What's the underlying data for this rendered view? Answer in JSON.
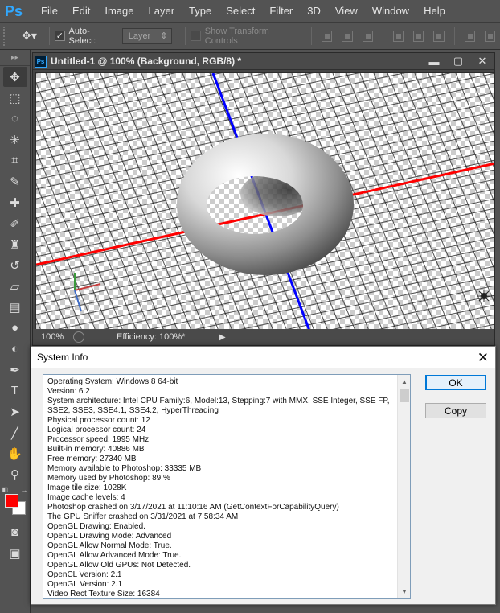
{
  "app": {
    "logo": "Ps"
  },
  "menu": [
    "File",
    "Edit",
    "Image",
    "Layer",
    "Type",
    "Select",
    "Filter",
    "3D",
    "View",
    "Window",
    "Help"
  ],
  "options": {
    "move_icon": "move-tool-icon",
    "auto_select_label": "Auto-Select:",
    "auto_select_checked": true,
    "target_select": "Layer",
    "show_transform_label": "Show Transform Controls",
    "show_transform_checked": false
  },
  "tools": [
    "move-tool-icon",
    "marquee-tool-icon",
    "lasso-tool-icon",
    "magic-wand-icon",
    "crop-tool-icon",
    "eyedropper-icon",
    "healing-brush-icon",
    "brush-tool-icon",
    "clone-stamp-icon",
    "history-brush-icon",
    "eraser-icon",
    "gradient-tool-icon",
    "blur-tool-icon",
    "dodge-tool-icon",
    "pen-tool-icon",
    "type-tool-icon",
    "path-selection-icon",
    "line-tool-icon",
    "hand-tool-icon",
    "zoom-tool-icon"
  ],
  "colors": {
    "foreground": "#ff0000",
    "background": "#ffffff"
  },
  "document": {
    "title": "Untitled-1 @ 100% (Background, RGB/8) *",
    "zoom": "100%",
    "efficiency": "Efficiency: 100%*"
  },
  "dialog": {
    "title": "System Info",
    "ok_label": "OK",
    "copy_label": "Copy",
    "lines": [
      "Operating System: Windows 8 64-bit",
      "Version: 6.2",
      "System architecture: Intel CPU Family:6, Model:13, Stepping:7 with MMX, SSE Integer, SSE FP,",
      "SSE2, SSE3, SSE4.1, SSE4.2, HyperThreading",
      "Physical processor count: 12",
      "Logical processor count: 24",
      "Processor speed: 1995 MHz",
      "Built-in memory: 40886 MB",
      "Free memory: 27340 MB",
      "Memory available to Photoshop: 33335 MB",
      "Memory used by Photoshop: 89 %",
      "Image tile size: 1028K",
      "Image cache levels: 4",
      "Photoshop crashed on 3/17/2021 at 11:10:16 AM (GetContextForCapabilityQuery)",
      "The GPU Sniffer crashed on 3/31/2021 at 7:58:34 AM",
      "OpenGL Drawing: Enabled.",
      "OpenGL Drawing Mode: Advanced",
      "OpenGL Allow Normal Mode: True.",
      "OpenGL Allow Advanced Mode: True.",
      "OpenGL Allow Old GPUs: Not Detected.",
      "OpenCL Version: 2.1",
      "OpenGL Version: 2.1",
      "Video Rect Texture Size: 16384"
    ]
  }
}
